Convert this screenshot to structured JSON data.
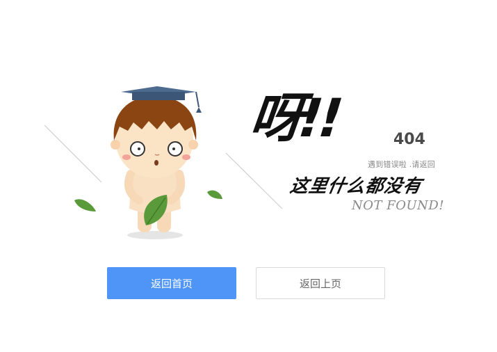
{
  "error": {
    "exclaim": "呀!!",
    "code": "404",
    "hint": "遇到错误啦 .请返回",
    "headline": "这里什么都没有",
    "subtitle": "NOT FOUND!"
  },
  "actions": {
    "home_label": "返回首页",
    "back_label": "返回上页"
  },
  "colors": {
    "primary": "#4f95f7",
    "leaf": "#5a9a3a",
    "hair": "#8b4513",
    "cap": "#4d6a8f"
  }
}
